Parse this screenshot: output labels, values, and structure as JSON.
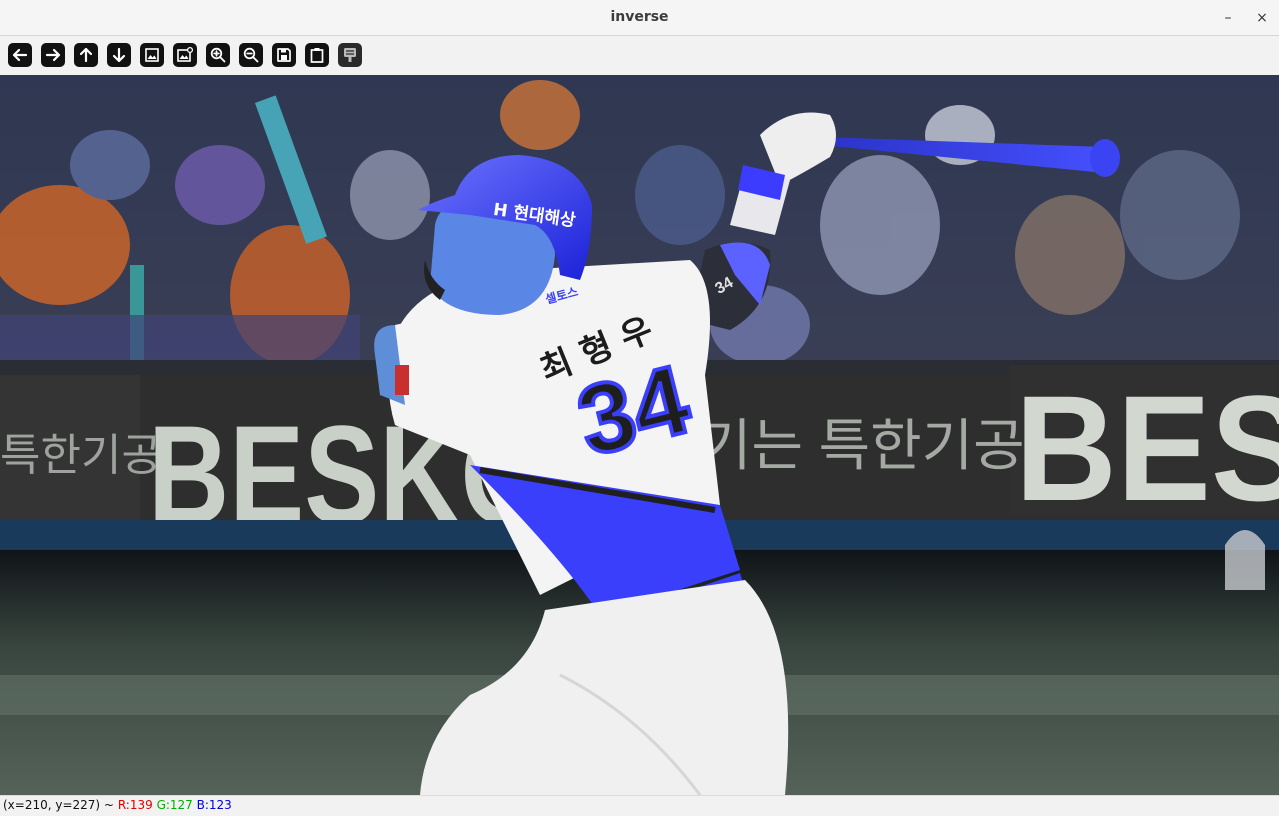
{
  "window": {
    "title": "inverse",
    "minimize_glyph": "–",
    "close_glyph": "×"
  },
  "toolbar": [
    {
      "name": "arrow-left-icon"
    },
    {
      "name": "arrow-right-icon"
    },
    {
      "name": "arrow-up-icon"
    },
    {
      "name": "arrow-down-icon"
    },
    {
      "name": "image-icon"
    },
    {
      "name": "image-settings-icon"
    },
    {
      "name": "zoom-in-icon"
    },
    {
      "name": "zoom-out-icon"
    },
    {
      "name": "save-icon"
    },
    {
      "name": "clipboard-icon"
    },
    {
      "name": "properties-icon"
    }
  ],
  "image": {
    "banner_left": "BESKO",
    "banner_right": "BES",
    "korean_left": "특한기공",
    "korean_right": "기는 특한기공",
    "helmet_text": "H 현대해상",
    "jersey_name": "최 형 우",
    "jersey_number": "34",
    "jersey_patch": "셀토스",
    "sleeve_number": "34"
  },
  "status": {
    "coords": "(x=210, y=227) ~",
    "r": "R:139",
    "g": "G:127",
    "b": "B:123",
    "r_color": "#e00000",
    "g_color": "#00b000",
    "b_color": "#0000e0"
  }
}
